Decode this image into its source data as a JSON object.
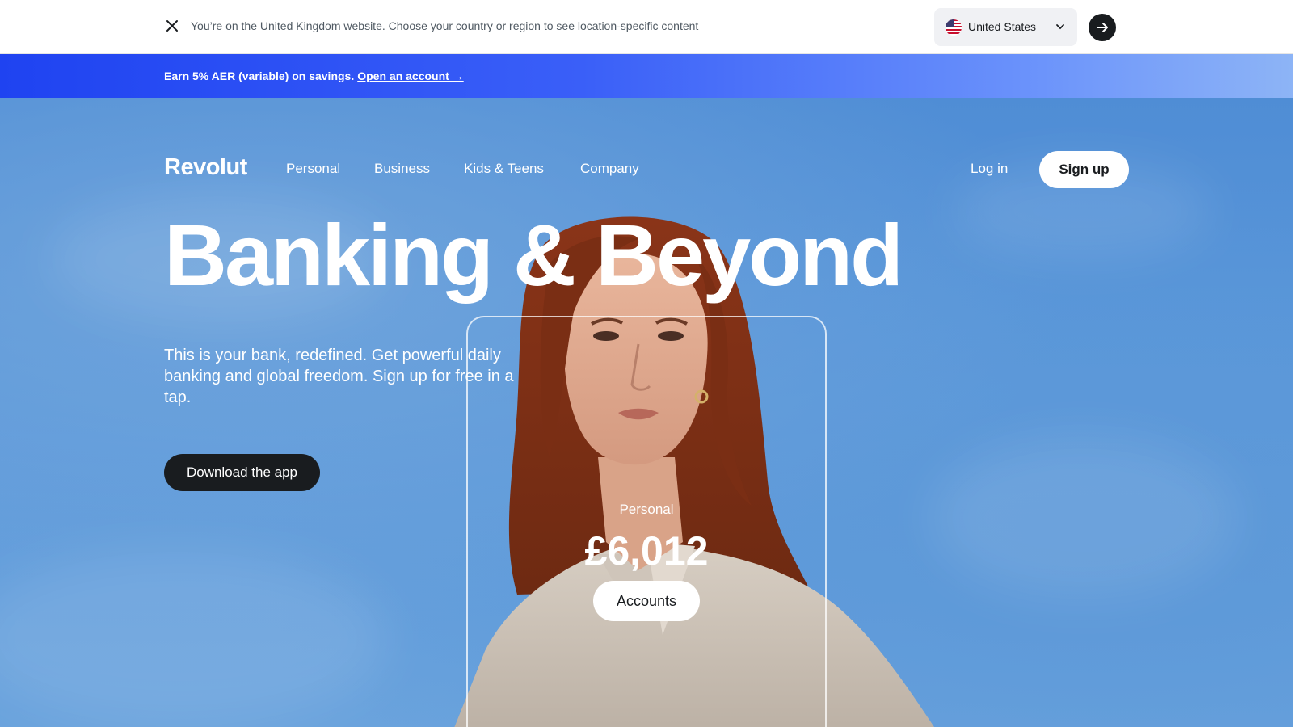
{
  "region_bar": {
    "message": "You’re on the United Kingdom website. Choose your country or region to see location-specific content",
    "selected_country": "United States",
    "close_icon": "close-icon",
    "go_icon": "arrow-right-icon"
  },
  "promo": {
    "text": "Earn 5% AER (variable) on savings.",
    "link": "Open an account →",
    "gradient_start": "#1f43f1",
    "gradient_end": "#8db4f6"
  },
  "nav": {
    "logo": "Revolut",
    "items": [
      "Personal",
      "Business",
      "Kids & Teens",
      "Company"
    ],
    "login": "Log in",
    "signup": "Sign up"
  },
  "hero": {
    "headline": "Banking & Beyond",
    "subtext": "This is your bank, redefined. Get powerful daily banking and global freedom. Sign up for free in a tap.",
    "cta": "Download the app",
    "card": {
      "label": "Personal",
      "amount": "£6,012",
      "button": "Accounts"
    }
  },
  "colors": {
    "dark": "#191c1f",
    "sky": "#5b98da"
  }
}
